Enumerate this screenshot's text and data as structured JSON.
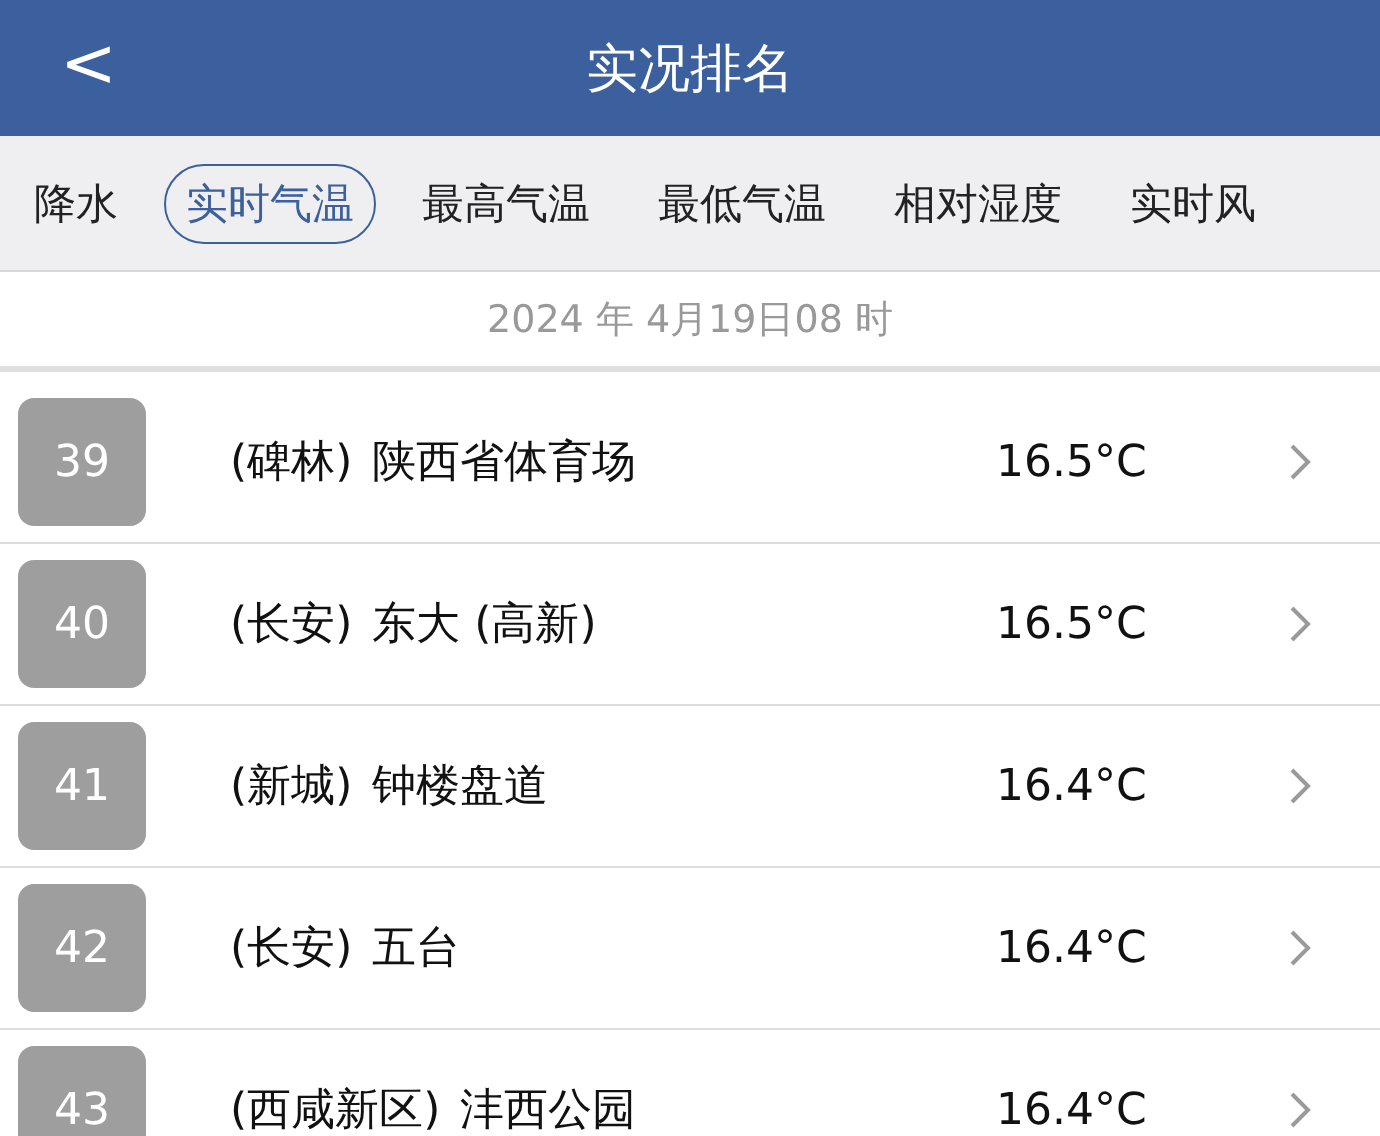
{
  "header": {
    "title": "实况排名",
    "back": "<"
  },
  "tabs": [
    {
      "label": "降水",
      "selected": false
    },
    {
      "label": "实时气温",
      "selected": true
    },
    {
      "label": "最高气温",
      "selected": false
    },
    {
      "label": "最低气温",
      "selected": false
    },
    {
      "label": "相对湿度",
      "selected": false
    },
    {
      "label": "实时风",
      "selected": false
    }
  ],
  "date": "2024 年 4月19日08 时",
  "rows": [
    {
      "rank": "39",
      "district": "(碑林)",
      "station": "陕西省体育场",
      "value": "16.5°C"
    },
    {
      "rank": "40",
      "district": "(长安)",
      "station": "东大 (高新)",
      "value": "16.5°C"
    },
    {
      "rank": "41",
      "district": "(新城)",
      "station": "钟楼盘道",
      "value": "16.4°C"
    },
    {
      "rank": "42",
      "district": "(长安)",
      "station": "五台",
      "value": "16.4°C"
    },
    {
      "rank": "43",
      "district": "(西咸新区)",
      "station": "沣西公园",
      "value": "16.4°C"
    }
  ]
}
